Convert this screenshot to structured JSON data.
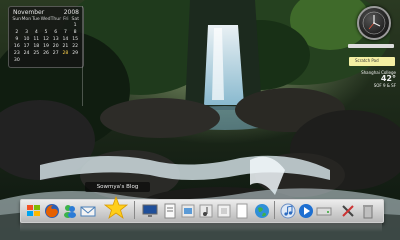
{
  "calendar": {
    "month": "November",
    "year": "2008",
    "weekdays": [
      "Sun",
      "Mon",
      "Tue",
      "Wed",
      "Thur",
      "Fri",
      "Sat"
    ],
    "weeks": [
      [
        "",
        "",
        "",
        "",
        "",
        "",
        "1"
      ],
      [
        "2",
        "3",
        "4",
        "5",
        "6",
        "7",
        "8"
      ],
      [
        "9",
        "10",
        "11",
        "12",
        "13",
        "14",
        "15"
      ],
      [
        "16",
        "17",
        "18",
        "19",
        "20",
        "21",
        "22"
      ],
      [
        "23",
        "24",
        "25",
        "26",
        "27",
        "28",
        "29"
      ],
      [
        "30",
        "",
        "",
        "",
        "",
        "",
        ""
      ]
    ],
    "today": "28",
    "today_color": "#ffd34d"
  },
  "side_panel": {
    "note_text": "Scratch Pad",
    "weather": {
      "city": "Shanghai College",
      "temperature": "42°",
      "range": "SOF 9 & SF"
    }
  },
  "dock": {
    "tooltip": "Sowmya's Blog",
    "icons": [
      "windows-flag",
      "firefox",
      "messenger",
      "mail",
      "star",
      "monitor",
      "document",
      "pictures-folder",
      "music-folder",
      "documents-folder",
      "blank-page",
      "globe",
      "itunes",
      "media-player",
      "drive",
      "tools",
      "recycle-bin"
    ]
  }
}
